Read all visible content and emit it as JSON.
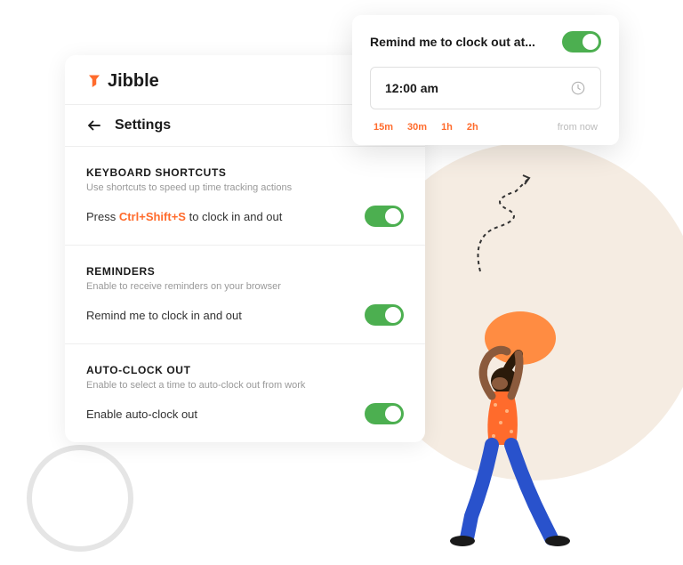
{
  "brand": {
    "name": "Jibble"
  },
  "page": {
    "title": "Settings"
  },
  "sections": {
    "shortcuts": {
      "title": "KEYBOARD SHORTCUTS",
      "desc": "Use shortcuts to speed up time tracking actions",
      "label_prefix": "Press ",
      "keycombo": "Ctrl+Shift+S",
      "label_suffix": " to clock in and out"
    },
    "reminders": {
      "title": "REMINDERS",
      "desc": "Enable to receive reminders on your browser",
      "label": "Remind me to clock in and out"
    },
    "autoclock": {
      "title": "AUTO-CLOCK OUT",
      "desc": "Enable to select a time to auto-clock out from work",
      "label": "Enable auto-clock out"
    }
  },
  "popup": {
    "title": "Remind me to clock out at...",
    "time": "12:00 am",
    "quick": [
      "15m",
      "30m",
      "1h",
      "2h"
    ],
    "quick_label": "from now"
  },
  "colors": {
    "accent": "#ff6b2c",
    "toggle": "#4caf50"
  }
}
